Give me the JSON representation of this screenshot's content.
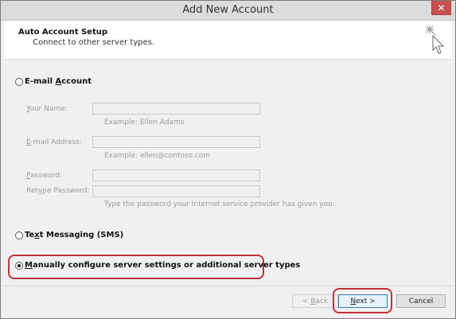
{
  "window": {
    "title": "Add New Account",
    "close_symbol": "✕"
  },
  "header": {
    "title": "Auto Account Setup",
    "subtitle": "Connect to other server types.",
    "icon": "wizard-cursor-icon"
  },
  "options": {
    "email_account": {
      "pre": "E-mail ",
      "ul": "A",
      "post": "ccount",
      "selected": false
    },
    "text_messaging": {
      "pre": "Te",
      "ul": "x",
      "post": "t Messaging (SMS)",
      "selected": false
    },
    "manual_config": {
      "pre": "",
      "ul": "M",
      "post": "anually configure server settings or additional server types",
      "selected": true
    }
  },
  "fields": {
    "your_name": {
      "label_ul": "Y",
      "label_rest": "our Name:",
      "value": "",
      "hint": "Example: Ellen Adams"
    },
    "email_address": {
      "label_ul": "E",
      "label_rest": "-mail Address:",
      "value": "",
      "hint": "Example: ellen@contoso.com"
    },
    "password": {
      "label_ul": "P",
      "label_rest": "assword:",
      "value": ""
    },
    "retype_password": {
      "label_pre": "Ret",
      "label_ul": "y",
      "label_rest": "pe Password:",
      "value": "",
      "hint": "Type the password your Internet service provider has given you."
    }
  },
  "buttons": {
    "back": {
      "pre": "< ",
      "ul": "B",
      "post": "ack",
      "enabled": false
    },
    "next": {
      "pre": "",
      "ul": "N",
      "post": "ext >",
      "enabled": true
    },
    "cancel": {
      "label": "Cancel"
    }
  },
  "colors": {
    "highlight_outline": "#c0303b",
    "close_button": "#c75050",
    "default_button_border": "#3c7fb1"
  }
}
